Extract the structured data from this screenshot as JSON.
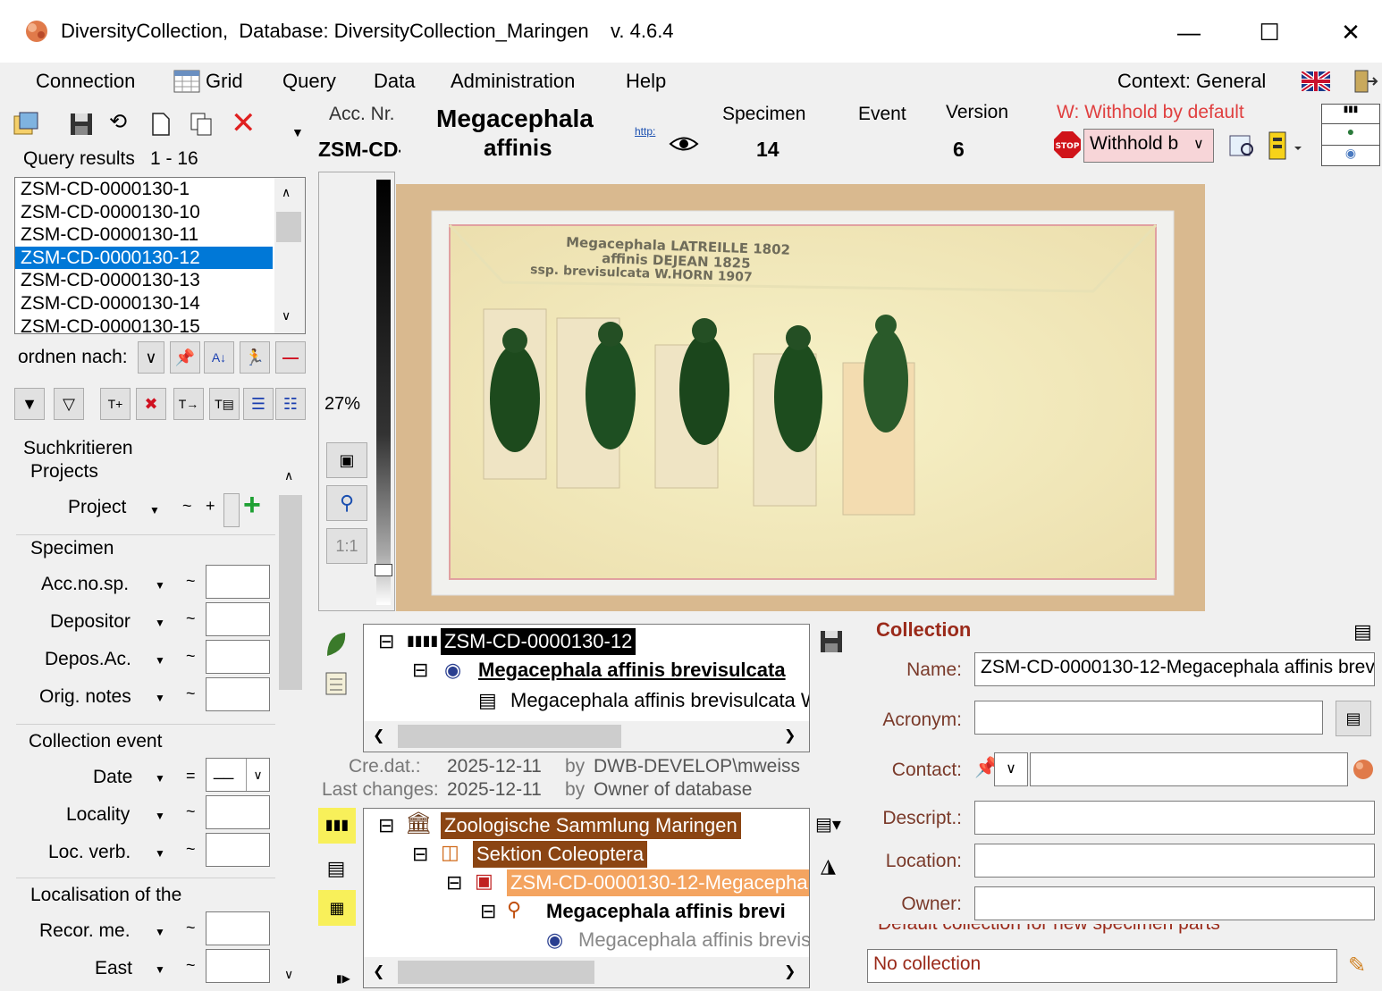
{
  "window": {
    "title": "DiversityCollection,  Database: DiversityCollection_Maringen    v. 4.6.4"
  },
  "menu": {
    "connection": "Connection",
    "grid": "Grid",
    "query": "Query",
    "data": "Data",
    "administration": "Administration",
    "help": "Help",
    "context": "Context: General"
  },
  "header": {
    "acc_label": "Acc. Nr.",
    "acc_value": "ZSM-CD-",
    "taxon_line1": "Megacephala",
    "taxon_line2": "affinis",
    "http_label": "http:",
    "specimen_label": "Specimen",
    "specimen_value": "14",
    "event_label": "Event",
    "version_label": "Version",
    "version_value": "6",
    "withhold_label": "W: Withhold by default",
    "withhold_value": "Withhold b"
  },
  "query": {
    "results_label": "Query results",
    "results_range": "1 - 16",
    "items": [
      "ZSM-CD-0000130-1",
      "ZSM-CD-0000130-10",
      "ZSM-CD-0000130-11",
      "ZSM-CD-0000130-12",
      "ZSM-CD-0000130-13",
      "ZSM-CD-0000130-14",
      "ZSM-CD-0000130-15"
    ],
    "order_by_label": "ordnen nach:"
  },
  "criteria": {
    "title": "Suchkritieren",
    "projects_group": "Projects",
    "project_label": "Project",
    "specimen_group": "Specimen",
    "acc_no_sp": "Acc.no.sp.",
    "depositor": "Depositor",
    "depos_ac": "Depos.Ac.",
    "orig_notes": "Orig. notes",
    "event_group": "Collection event",
    "date": "Date",
    "locality": "Locality",
    "loc_verb": "Loc. verb.",
    "localisation_group": "Localisation of the",
    "recor_me": "Recor. me.",
    "east": "East",
    "tilde": "~",
    "equals": "="
  },
  "image": {
    "zoom": "27%",
    "one_to_one": "1:1",
    "label_line1": "Megacephala LATREILLE 1802",
    "label_line2": "affinis DEJEAN 1825",
    "label_line3": "ssp. brevisulcata W.HORN 1907"
  },
  "tree_top": {
    "root": "ZSM-CD-0000130-12",
    "taxon": "Megacephala affinis brevisulcata",
    "child": "Megacephala affinis brevisulcata W"
  },
  "meta": {
    "cre_label": "Cre.dat.:",
    "cre_date": "2025-12-11",
    "by1": "by",
    "cre_user": "DWB-DEVELOP\\mweiss",
    "last_label": "Last changes:",
    "last_date": "2025-12-11",
    "by2": "by",
    "last_user": "Owner of database"
  },
  "tree_bottom": {
    "n1": "Zoologische Sammlung Maringen",
    "n2": "Sektion Coleoptera",
    "n3": "ZSM-CD-0000130-12-Megacephala",
    "n4": "Megacephala affinis brevi",
    "n5": "Megacephala affinis brevis"
  },
  "collection": {
    "title": "Collection",
    "name_label": "Name:",
    "name_value": "ZSM-CD-0000130-12-Megacephala affinis brev",
    "acronym_label": "Acronym:",
    "contact_label": "Contact:",
    "descript_label": "Descript.:",
    "location_label": "Location:",
    "owner_label": "Owner:",
    "default_label": "Default collection for new specimen parts",
    "default_value": "No collection"
  },
  "colors": {
    "selection": "#0078d7",
    "tree_brown": "#8b4513",
    "tree_orange": "#f4a460",
    "label_red": "#c0392b"
  }
}
